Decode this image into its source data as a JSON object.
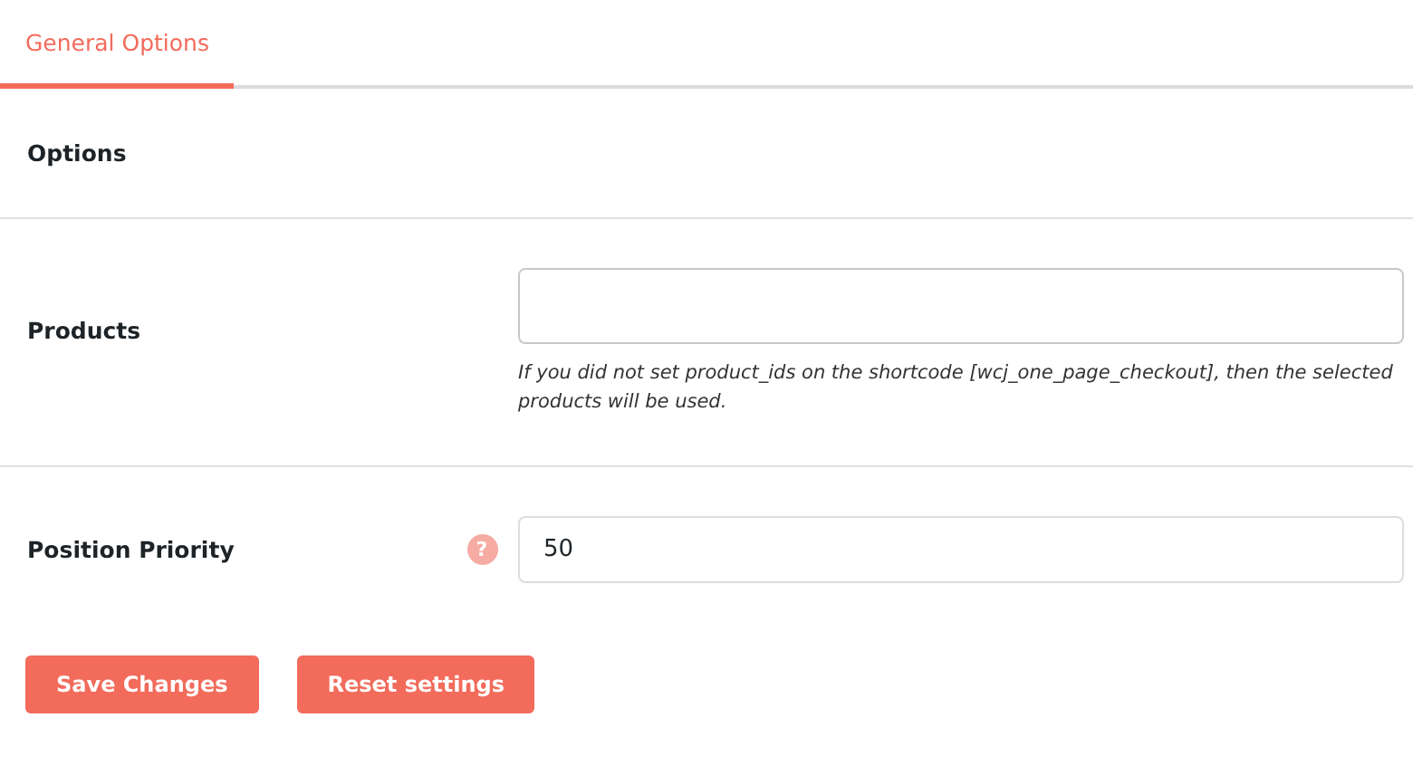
{
  "tabs": [
    {
      "label": "General Options",
      "selected": true
    }
  ],
  "section_title": "Options",
  "fields": [
    {
      "label": "Products",
      "description": "If you did not set product_ids on the shortcode [wcj_one_page_checkout], then the selected products will be used."
    },
    {
      "label": "Position Priority",
      "value": "50",
      "help": "?"
    }
  ],
  "buttons": [
    "Save Changes",
    "Reset settings"
  ]
}
